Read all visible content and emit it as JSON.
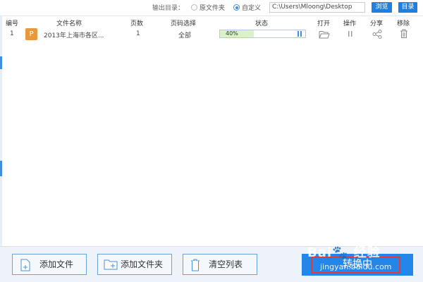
{
  "toolbar": {
    "output_label": "输出目录：",
    "option_source": "原文件夹",
    "option_custom": "自定义",
    "path_value": "C:\\Users\\Mloong\\Desktop",
    "browse_label": "浏览",
    "dir_label": "目录"
  },
  "table": {
    "headers": {
      "num": "编号",
      "name": "文件名称",
      "pages": "页数",
      "range": "页码选择",
      "status": "状态",
      "open": "打开",
      "op": "操作",
      "share": "分享",
      "remove": "移除"
    },
    "rows": [
      {
        "num": "1",
        "badge": "P",
        "name": "2013年上海市各区...",
        "pages": "1",
        "range": "全部",
        "progress_text": "40%",
        "progress": 40
      }
    ]
  },
  "bottom": {
    "add_file": "添加文件",
    "add_folder": "添加文件夹",
    "clear_list": "清空列表",
    "convert": "转换中"
  },
  "watermark": {
    "text": "Bai🐾 经验",
    "sub": "jingyan.baidu.com"
  },
  "colors": {
    "accent": "#1f7fe0",
    "badge": "#e8993c",
    "progress_fill": "#d9f2c7",
    "highlight": "#e53935"
  },
  "icons": {
    "open": "folder-open-icon",
    "op": "pause-icon",
    "share": "share-icon",
    "remove": "trash-icon"
  }
}
